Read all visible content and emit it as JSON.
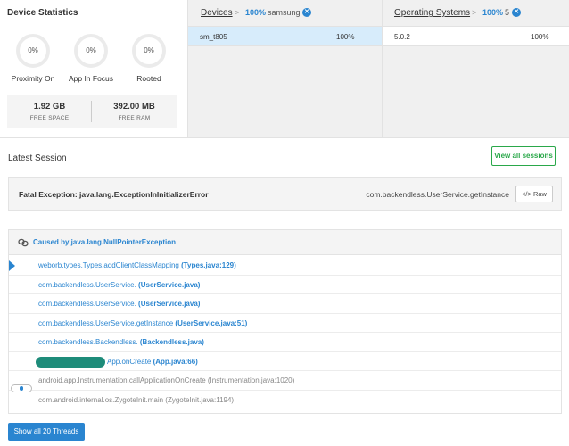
{
  "device_statistics": {
    "title": "Device Statistics",
    "rings": [
      {
        "value": "0%",
        "label": "Proximity On"
      },
      {
        "value": "0%",
        "label": "App In Focus"
      },
      {
        "value": "0%",
        "label": "Rooted"
      }
    ],
    "storage": [
      {
        "value": "1.92 GB",
        "label": "FREE SPACE"
      },
      {
        "value": "392.00 MB",
        "label": "FREE RAM"
      }
    ]
  },
  "devices_panel": {
    "title": "Devices",
    "arrow": ">",
    "filter_pct": "100%",
    "filter_name": "samsung",
    "row": {
      "name": "sm_t805",
      "pct": "100%"
    }
  },
  "os_panel": {
    "title": "Operating Systems",
    "arrow": ">",
    "filter_pct": "100%",
    "filter_name": "5",
    "row": {
      "name": "5.0.2",
      "pct": "100%"
    }
  },
  "latest_session": {
    "title": "Latest Session",
    "view_all_label": "View all sessions"
  },
  "fatal": {
    "title": "Fatal Exception: java.lang.ExceptionInInitializerError",
    "method": "com.backendless.UserService.getInstance",
    "raw_label": "Raw"
  },
  "trace": {
    "caused_by": "Caused by java.lang.NullPointerException",
    "rows": [
      {
        "method": "weborb.types.Types.addClientClassMapping ",
        "file": "(Types.java:129)"
      },
      {
        "method": "com.backendless.UserService. ",
        "file": "(UserService.java)"
      },
      {
        "method": "com.backendless.UserService. ",
        "file": "(UserService.java)"
      },
      {
        "method": "com.backendless.UserService.getInstance ",
        "file": "(UserService.java:51)"
      },
      {
        "method": "com.backendless.Backendless. ",
        "file": "(Backendless.java)"
      },
      {
        "method": "App.onCreate ",
        "file": "(App.java:66)"
      },
      {
        "method": "android.app.Instrumentation.callApplicationOnCreate ",
        "file": "(Instrumentation.java:1020)"
      },
      {
        "method": "com.android.internal.os.ZygoteInit.main ",
        "file": "(ZygoteInit.java:1194)"
      }
    ]
  },
  "show_threads_label": "Show all 20 Threads",
  "colors": {
    "accent": "#2a85d0",
    "success": "#2aa84a",
    "selected_row": "#d7ecfb"
  },
  "icons": [
    "close-circle-icon",
    "link-icon",
    "code-icon",
    "active-frame-marker-icon",
    "collapse-toggle-icon"
  ]
}
